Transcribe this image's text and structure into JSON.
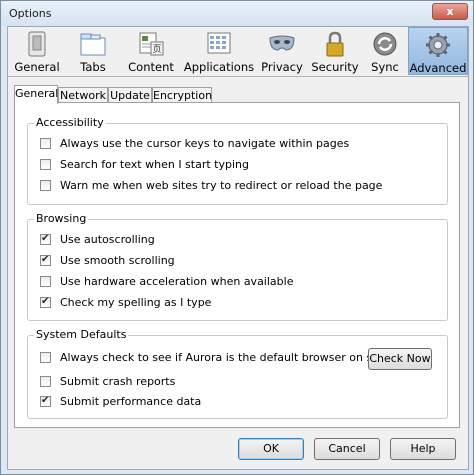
{
  "window": {
    "title": "Options",
    "close_glyph": "x"
  },
  "toolbar": {
    "items": [
      {
        "label": "General",
        "icon": "general-icon"
      },
      {
        "label": "Tabs",
        "icon": "tabs-icon"
      },
      {
        "label": "Content",
        "icon": "content-icon"
      },
      {
        "label": "Applications",
        "icon": "applications-icon"
      },
      {
        "label": "Privacy",
        "icon": "privacy-mask-icon"
      },
      {
        "label": "Security",
        "icon": "padlock-icon"
      },
      {
        "label": "Sync",
        "icon": "sync-icon"
      },
      {
        "label": "Advanced",
        "icon": "gear-icon"
      }
    ],
    "selected": "Advanced"
  },
  "tabs": [
    "General",
    "Network",
    "Update",
    "Encryption"
  ],
  "active_tab": "General",
  "accessibility": {
    "title": "Accessibility",
    "items": [
      {
        "label": "Always use the cursor keys to navigate within pages",
        "checked": false
      },
      {
        "label": "Search for text when I start typing",
        "checked": false
      },
      {
        "label": "Warn me when web sites try to redirect or reload the page",
        "checked": false
      }
    ]
  },
  "browsing": {
    "title": "Browsing",
    "items": [
      {
        "label": "Use autoscrolling",
        "checked": true
      },
      {
        "label": "Use smooth scrolling",
        "checked": true
      },
      {
        "label": "Use hardware acceleration when available",
        "checked": false
      },
      {
        "label": "Check my spelling as I type",
        "checked": true
      }
    ]
  },
  "system_defaults": {
    "title": "System Defaults",
    "items": [
      {
        "label": "Always check to see if Aurora is the default browser on startup",
        "checked": false
      },
      {
        "label": "Submit crash reports",
        "checked": false
      },
      {
        "label": "Submit performance data",
        "checked": true
      }
    ],
    "check_now_label": "Check Now"
  },
  "footer": {
    "ok_label": "OK",
    "cancel_label": "Cancel",
    "help_label": "Help"
  }
}
